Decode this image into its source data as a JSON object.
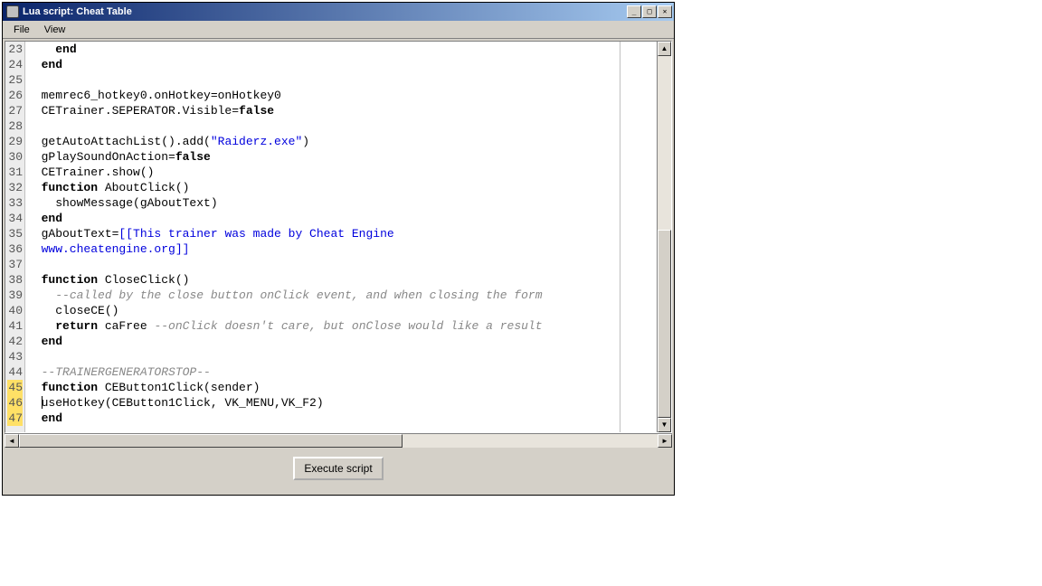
{
  "window": {
    "title": "Lua script: Cheat Table"
  },
  "menu": {
    "file": "File",
    "view": "View"
  },
  "editor": {
    "first_line_number": 23,
    "last_line_number": 47,
    "modified_lines": [
      45,
      46,
      47
    ],
    "caret_line": 46,
    "caret_col": 0,
    "lines": [
      {
        "n": 23,
        "segs": [
          {
            "t": "    "
          },
          {
            "t": "end",
            "c": "kw"
          }
        ]
      },
      {
        "n": 24,
        "segs": [
          {
            "t": "  "
          },
          {
            "t": "end",
            "c": "kw"
          }
        ]
      },
      {
        "n": 25,
        "segs": []
      },
      {
        "n": 26,
        "segs": [
          {
            "t": "  memrec6_hotkey0.onHotkey=onHotkey0"
          }
        ]
      },
      {
        "n": 27,
        "segs": [
          {
            "t": "  CETrainer.SEPERATOR.Visible="
          },
          {
            "t": "false",
            "c": "kw"
          }
        ]
      },
      {
        "n": 28,
        "segs": []
      },
      {
        "n": 29,
        "segs": [
          {
            "t": "  getAutoAttachList().add("
          },
          {
            "t": "\"Raiderz.exe\"",
            "c": "str"
          },
          {
            "t": ")"
          }
        ]
      },
      {
        "n": 30,
        "segs": [
          {
            "t": "  gPlaySoundOnAction="
          },
          {
            "t": "false",
            "c": "kw"
          }
        ]
      },
      {
        "n": 31,
        "segs": [
          {
            "t": "  CETrainer.show()"
          }
        ]
      },
      {
        "n": 32,
        "segs": [
          {
            "t": "  "
          },
          {
            "t": "function",
            "c": "kw"
          },
          {
            "t": " AboutClick()"
          }
        ]
      },
      {
        "n": 33,
        "segs": [
          {
            "t": "    showMessage(gAboutText)"
          }
        ]
      },
      {
        "n": 34,
        "segs": [
          {
            "t": "  "
          },
          {
            "t": "end",
            "c": "kw"
          }
        ]
      },
      {
        "n": 35,
        "segs": [
          {
            "t": "  gAboutText="
          },
          {
            "t": "[[This trainer was made by Cheat Engine",
            "c": "str"
          }
        ]
      },
      {
        "n": 36,
        "segs": [
          {
            "t": "  www.cheatengine.org]]",
            "c": "str"
          }
        ]
      },
      {
        "n": 37,
        "segs": []
      },
      {
        "n": 38,
        "segs": [
          {
            "t": "  "
          },
          {
            "t": "function",
            "c": "kw"
          },
          {
            "t": " CloseClick()"
          }
        ]
      },
      {
        "n": 39,
        "segs": [
          {
            "t": "    "
          },
          {
            "t": "--called by the close button onClick event, and when closing the form",
            "c": "com"
          }
        ]
      },
      {
        "n": 40,
        "segs": [
          {
            "t": "    closeCE()"
          }
        ]
      },
      {
        "n": 41,
        "segs": [
          {
            "t": "    "
          },
          {
            "t": "return",
            "c": "kw"
          },
          {
            "t": " caFree "
          },
          {
            "t": "--onClick doesn't care, but onClose would like a result",
            "c": "com"
          }
        ]
      },
      {
        "n": 42,
        "segs": [
          {
            "t": "  "
          },
          {
            "t": "end",
            "c": "kw"
          }
        ]
      },
      {
        "n": 43,
        "segs": []
      },
      {
        "n": 44,
        "segs": [
          {
            "t": "  "
          },
          {
            "t": "--TRAINERGENERATORSTOP--",
            "c": "com"
          }
        ]
      },
      {
        "n": 45,
        "segs": [
          {
            "t": "  "
          },
          {
            "t": "function",
            "c": "kw"
          },
          {
            "t": " CEButton1Click(sender)"
          }
        ]
      },
      {
        "n": 46,
        "segs": [
          {
            "t": "  useHotkey(CEButton1Click, VK_MENU,VK_F2)"
          }
        ]
      },
      {
        "n": 47,
        "segs": [
          {
            "t": "  "
          },
          {
            "t": "end",
            "c": "kw"
          }
        ]
      }
    ]
  },
  "buttons": {
    "execute": "Execute script"
  },
  "scroll": {
    "vthumb_top_pct": 48,
    "vthumb_height_pct": 52,
    "hthumb_left_pct": 0,
    "hthumb_width_pct": 60
  }
}
